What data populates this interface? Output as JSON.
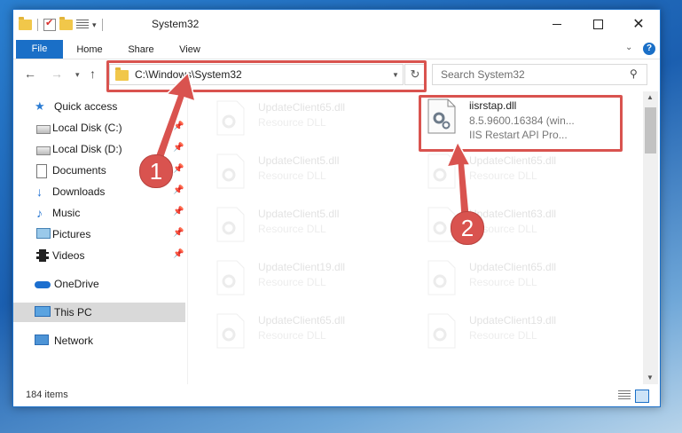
{
  "window": {
    "title": "System32",
    "controls": {
      "minimize": "minimize",
      "maximize": "maximize",
      "close": "✕"
    }
  },
  "ribbon": {
    "tabs": [
      "File",
      "Home",
      "Share",
      "View"
    ],
    "help": "?"
  },
  "navigation": {
    "back": "←",
    "forward": "→",
    "recent": "▾",
    "up": "↑",
    "address": "C:\\Windows\\System32",
    "refresh": "↻",
    "search_placeholder": "Search System32"
  },
  "sidebar": {
    "items": [
      {
        "label": "Quick access",
        "icon": "star-icon",
        "pinned": false
      },
      {
        "label": "Local Disk (C:)",
        "icon": "drive-icon",
        "pinned": true
      },
      {
        "label": "Local Disk (D:)",
        "icon": "drive-icon",
        "pinned": true
      },
      {
        "label": "Documents",
        "icon": "document-icon",
        "pinned": true
      },
      {
        "label": "Downloads",
        "icon": "download-icon",
        "pinned": true
      },
      {
        "label": "Music",
        "icon": "music-icon",
        "pinned": true
      },
      {
        "label": "Pictures",
        "icon": "picture-icon",
        "pinned": true
      },
      {
        "label": "Videos",
        "icon": "video-icon",
        "pinned": true
      },
      {
        "label": "OneDrive",
        "icon": "cloud-icon",
        "pinned": false
      },
      {
        "label": "This PC",
        "icon": "computer-icon",
        "pinned": false,
        "selected": true
      },
      {
        "label": "Network",
        "icon": "network-icon",
        "pinned": false
      }
    ],
    "pin_glyph": "📌"
  },
  "files": {
    "highlighted": {
      "name": "iisrstap.dll",
      "version": "8.5.9600.16384 (win...",
      "description": "IIS Restart API Pro..."
    },
    "left_column": [
      {
        "name": "UpdateClient65.dll",
        "type": "Resource DLL"
      },
      {
        "name": "UpdateClient5.dll",
        "type": "Resource DLL"
      },
      {
        "name": "UpdateClient5.dll",
        "type": "Resource DLL"
      },
      {
        "name": "UpdateClient19.dll",
        "type": "Resource DLL"
      },
      {
        "name": "UpdateClient65.dll",
        "type": "Resource DLL"
      }
    ],
    "right_column": [
      {
        "name": "UpdateClient65.dll",
        "type": "Resource DLL"
      },
      {
        "name": "UpdateClient63.dll",
        "type": "Resource DLL"
      },
      {
        "name": "UpdateClient65.dll",
        "type": "Resource DLL"
      },
      {
        "name": "UpdateClient19.dll",
        "type": "Resource DLL"
      }
    ]
  },
  "status": {
    "item_count": "184 items"
  },
  "callouts": {
    "one": "1",
    "two": "2"
  },
  "colors": {
    "accent": "#1a6fc7",
    "highlight": "#d9534f"
  }
}
